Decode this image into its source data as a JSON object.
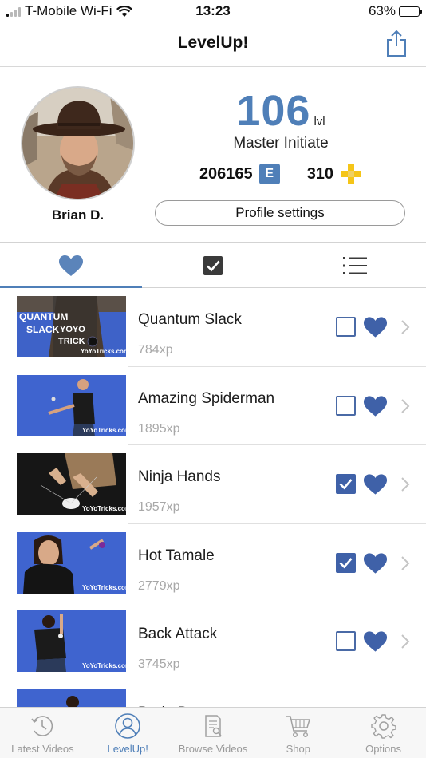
{
  "status_bar": {
    "carrier": "T-Mobile Wi-Fi",
    "time": "13:23",
    "battery": "63%",
    "battery_level": 0.63
  },
  "nav": {
    "title": "LevelUp!",
    "share_icon": "share-icon"
  },
  "profile": {
    "name": "Brian D.",
    "level": "106",
    "level_unit": "lvl",
    "rank": "Master Initiate",
    "xp_total": "206165",
    "xp_badge": "E",
    "points": "310",
    "settings_label": "Profile settings"
  },
  "tabs": [
    {
      "icon": "heart-icon",
      "active": true
    },
    {
      "icon": "checkbox-icon",
      "active": false
    },
    {
      "icon": "list-icon",
      "active": false
    }
  ],
  "tricks": [
    {
      "name": "Quantum Slack",
      "xp": "784xp",
      "done": false,
      "thumb_text": [
        "QUANTUM",
        "SLACK",
        "YOYO",
        "TRICK",
        "YoYoTricks.com"
      ]
    },
    {
      "name": "Amazing Spiderman",
      "xp": "1895xp",
      "done": false,
      "thumb_text": [
        "YoYoTricks.com"
      ]
    },
    {
      "name": "Ninja Hands",
      "xp": "1957xp",
      "done": true,
      "thumb_text": [
        "YoYoTricks.com"
      ]
    },
    {
      "name": "Hot Tamale",
      "xp": "2779xp",
      "done": true,
      "thumb_text": [
        "YoYoTricks.com"
      ]
    },
    {
      "name": "Back Attack",
      "xp": "3745xp",
      "done": false,
      "thumb_text": [
        "YoYoTricks.com"
      ]
    },
    {
      "name": "Brain Bu...",
      "xp": "",
      "done": false,
      "thumb_text": []
    }
  ],
  "tab_bar": [
    {
      "label": "Latest Videos",
      "icon": "clock-icon",
      "active": false
    },
    {
      "label": "LevelUp!",
      "icon": "profile-icon",
      "active": true
    },
    {
      "label": "Browse Videos",
      "icon": "document-search-icon",
      "active": false
    },
    {
      "label": "Shop",
      "icon": "cart-icon",
      "active": false
    },
    {
      "label": "Options",
      "icon": "gear-icon",
      "active": false
    }
  ],
  "colors": {
    "accent": "#4f7fb8",
    "checked": "#3f61a8",
    "plus_yellow": "#f5c518",
    "inactive": "#9a9a9a"
  }
}
